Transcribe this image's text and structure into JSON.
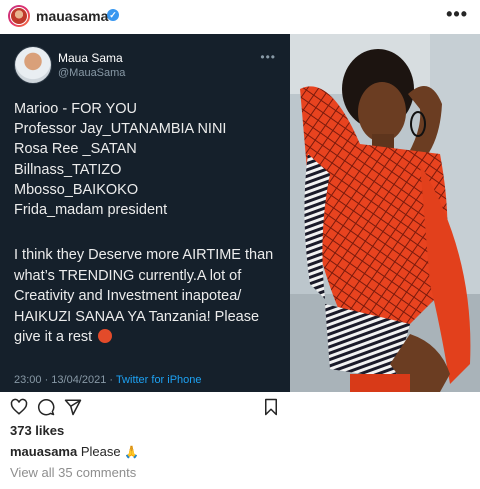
{
  "header": {
    "username": "mauasama",
    "more": "•••"
  },
  "tweet": {
    "name": "Maua Sama",
    "handle": "@MauaSama",
    "more": "•••",
    "lines": [
      "Marioo - FOR YOU",
      "Professor Jay_UTANAMBIA NINI",
      "Rosa Ree _SATAN",
      "Billnass_TATIZO",
      "Mbosso_BAIKOKO",
      "Frida_madam president"
    ],
    "paragraph": "I think they Deserve more AIRTIME than what’s TRENDING currently.A lot of Creativity and Investment inapotea/ HAIKUZI SANAA YA Tanzania!  Please give it a rest",
    "timestamp": "23:00 · 13/04/2021 · ",
    "source": "Twitter for iPhone"
  },
  "actions": {
    "icons": [
      "heart-icon",
      "comment-icon",
      "share-icon",
      "bookmark-icon"
    ]
  },
  "post": {
    "likes": "373 likes",
    "caption_user": "mauasama",
    "caption_text": " Please ",
    "view_comments": "View all 35 comments"
  },
  "colors": {
    "tweet_bg": "#15202b",
    "verified": "#3897f0",
    "link": "#1da1f2"
  }
}
